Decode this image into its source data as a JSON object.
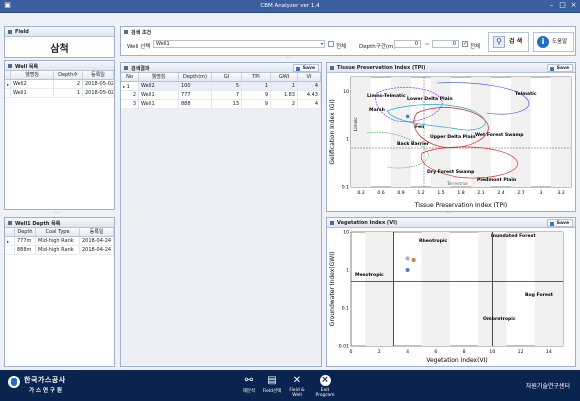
{
  "window": {
    "title": "CBM Analyzer ver 1.4"
  },
  "field": {
    "header": "Field",
    "value": "삼척"
  },
  "well_list": {
    "header": "Well 목록",
    "columns": [
      "웰명칭",
      "Depth수",
      "등록일"
    ],
    "rows": [
      [
        "Well2",
        "2",
        "2018-05-02"
      ],
      [
        "Well1",
        "1",
        "2018-05-02"
      ]
    ]
  },
  "depth_list": {
    "header": "Well1 Depth 목록",
    "columns": [
      "Depth",
      "Coal Type",
      "등록일"
    ],
    "rows": [
      [
        "777m",
        "Mid-high Rank",
        "2018-04-24"
      ],
      [
        "888m",
        "Mid-high Rank",
        "2018-04-24"
      ]
    ]
  },
  "search": {
    "header": "검색 조건",
    "well_label": "Well 선택",
    "well_value": "Well1",
    "all_label": "전체",
    "depth_label": "Depth구간(m)",
    "depth_from": "0",
    "depth_sep": "~",
    "depth_to": "0",
    "depth_all_label": "전체",
    "search_button": "검 색",
    "help_button": "도움말"
  },
  "results": {
    "header": "검색결과",
    "save_label": "Save",
    "columns": [
      "No",
      "웰명칭",
      "Depth(m)",
      "GI",
      "TPI",
      "GWI",
      "VI"
    ],
    "rows": [
      [
        "1",
        "Well2",
        "100",
        "5",
        "1",
        "1",
        "4"
      ],
      [
        "2",
        "Well1",
        "777",
        "7",
        "9",
        "1.83",
        "4.43"
      ],
      [
        "3",
        "Well1",
        "888",
        "13",
        "9",
        "2",
        "4"
      ]
    ]
  },
  "tpi_panel": {
    "header": "Tissue Preservation Index (TPI)",
    "save_label": "Save",
    "chart_data": {
      "type": "scatter",
      "xlabel": "Tissue Preservation Index (TPI)",
      "ylabel": "Gelification Index (GI)",
      "xticks": [
        "0.3",
        "0.6",
        "0.9",
        "1.2",
        "1.5",
        "1.8",
        "2.1",
        "2.4",
        "2.7",
        "3",
        "3.3"
      ],
      "yticks": [
        "0.1",
        "1",
        "10"
      ],
      "regions": [
        "Limno-Telmatic",
        "Lower Delta Plain",
        "Telmatic",
        "Marsh",
        "Fen",
        "Upper Delta Plain",
        "Wet Forest Swamp",
        "Back Barrier",
        "Dry Forest Swamp",
        "Piedmont Plain",
        "Limnic",
        "Terrestrial"
      ],
      "points": [
        {
          "x": 1.0,
          "y": 3.0,
          "color": "#4a7fd0"
        }
      ]
    }
  },
  "vi_panel": {
    "header": "Vegetation Index (VI)",
    "save_label": "Save",
    "chart_data": {
      "type": "scatter",
      "xlabel": "Vegetation Index(VI)",
      "ylabel": "Groundwater Index(GWI)",
      "xlim": [
        0,
        15
      ],
      "ylim": [
        0.01,
        10
      ],
      "xticks": [
        0,
        2,
        4,
        6,
        8,
        10,
        12,
        14
      ],
      "yticks": [
        "0.01",
        "0.1",
        "1",
        "10"
      ],
      "regions": [
        "Rheotropic",
        "Inundated Forest",
        "Mesotropic",
        "Bog Forest",
        "Ombrotropic"
      ],
      "points": [
        {
          "x": 4,
          "y": 1,
          "color": "#4a7fd0"
        },
        {
          "x": 4.43,
          "y": 1.83,
          "color": "#e07a3a"
        },
        {
          "x": 4,
          "y": 2,
          "color": "#b0b0b0"
        }
      ]
    }
  },
  "footer": {
    "logo_main": "한국가스공사",
    "logo_sub": "가 스 연 구 원",
    "buttons": [
      "재분석",
      "Field선택",
      "Field & Well",
      "Exit Program"
    ],
    "right_text": "자원기술연구센터"
  }
}
